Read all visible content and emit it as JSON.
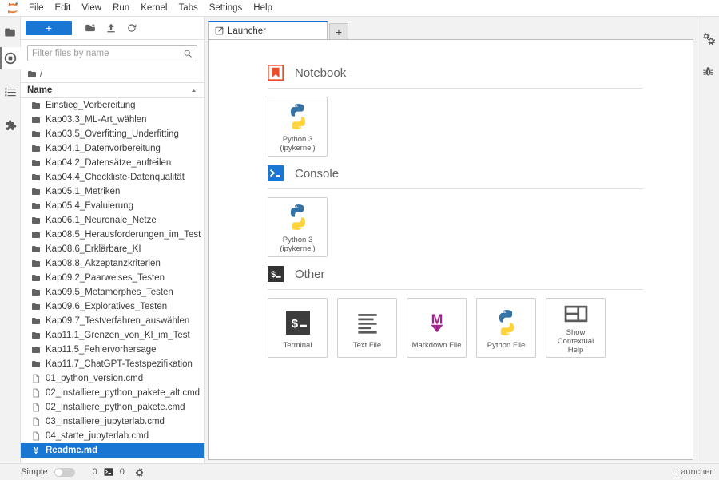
{
  "app": {
    "title": "JupyterLab",
    "logo_icon": "jupyter-logo-icon"
  },
  "menubar": {
    "items": [
      {
        "label": "File"
      },
      {
        "label": "Edit"
      },
      {
        "label": "View"
      },
      {
        "label": "Run"
      },
      {
        "label": "Kernel"
      },
      {
        "label": "Tabs"
      },
      {
        "label": "Settings"
      },
      {
        "label": "Help"
      }
    ]
  },
  "left_activity_bar": {
    "items": [
      {
        "name": "file-browser",
        "icon": "folder-icon",
        "active": true
      },
      {
        "name": "running-terminals-and-kernels",
        "icon": "stop-circle-icon",
        "active": false
      },
      {
        "name": "commands",
        "icon": "list-icon",
        "active": false
      },
      {
        "name": "extension-manager",
        "icon": "puzzle-piece-icon",
        "active": false
      }
    ]
  },
  "right_activity_bar": {
    "items": [
      {
        "name": "property-inspector",
        "icon": "gears-icon"
      },
      {
        "name": "debugger",
        "icon": "bug-icon"
      }
    ]
  },
  "file_browser": {
    "toolbar": {
      "new_launcher_label": "+",
      "new_folder_icon": "new-folder-icon",
      "upload_icon": "upload-icon",
      "refresh_icon": "refresh-icon"
    },
    "filter": {
      "placeholder": "Filter files by name",
      "value": "",
      "search_icon": "search-icon"
    },
    "breadcrumb": {
      "root_icon": "folder-icon",
      "path": "/"
    },
    "column_header": {
      "name_label": "Name",
      "sort_icon": "caret-up-icon"
    },
    "items": [
      {
        "label": "Einstieg_Vorbereitung",
        "type": "folder",
        "selected": false
      },
      {
        "label": "Kap03.3_ML-Art_wählen",
        "type": "folder",
        "selected": false
      },
      {
        "label": "Kap03.5_Overfitting_Underfitting",
        "type": "folder",
        "selected": false
      },
      {
        "label": "Kap04.1_Datenvorbereitung",
        "type": "folder",
        "selected": false
      },
      {
        "label": "Kap04.2_Datensätze_aufteilen",
        "type": "folder",
        "selected": false
      },
      {
        "label": "Kap04.4_Checkliste-Datenqualität",
        "type": "folder",
        "selected": false
      },
      {
        "label": "Kap05.1_Metriken",
        "type": "folder",
        "selected": false
      },
      {
        "label": "Kap05.4_Evaluierung",
        "type": "folder",
        "selected": false
      },
      {
        "label": "Kap06.1_Neuronale_Netze",
        "type": "folder",
        "selected": false
      },
      {
        "label": "Kap08.5_Herausforderungen_im_Test",
        "type": "folder",
        "selected": false
      },
      {
        "label": "Kap08.6_Erklärbare_KI",
        "type": "folder",
        "selected": false
      },
      {
        "label": "Kap08.8_Akzeptanzkriterien",
        "type": "folder",
        "selected": false
      },
      {
        "label": "Kap09.2_Paarweises_Testen",
        "type": "folder",
        "selected": false
      },
      {
        "label": "Kap09.5_Metamorphes_Testen",
        "type": "folder",
        "selected": false
      },
      {
        "label": "Kap09.6_Exploratives_Testen",
        "type": "folder",
        "selected": false
      },
      {
        "label": "Kap09.7_Testverfahren_auswählen",
        "type": "folder",
        "selected": false
      },
      {
        "label": "Kap11.1_Grenzen_von_KI_im_Test",
        "type": "folder",
        "selected": false
      },
      {
        "label": "Kap11.5_Fehlervorhersage",
        "type": "folder",
        "selected": false
      },
      {
        "label": "Kap11.7_ChatGPT-Testspezifikation",
        "type": "folder",
        "selected": false
      },
      {
        "label": "01_python_version.cmd",
        "type": "file",
        "selected": false
      },
      {
        "label": "02_installiere_python_pakete_alt.cmd",
        "type": "file",
        "selected": false
      },
      {
        "label": "02_installiere_python_pakete.cmd",
        "type": "file",
        "selected": false
      },
      {
        "label": "03_installiere_jupyterlab.cmd",
        "type": "file",
        "selected": false
      },
      {
        "label": "04_starte_jupyterlab.cmd",
        "type": "file",
        "selected": false
      },
      {
        "label": "Readme.md",
        "type": "markdown",
        "selected": true
      }
    ]
  },
  "dock": {
    "tab": {
      "label": "Launcher",
      "icon": "launcher-icon"
    },
    "add_tab_label": "+"
  },
  "launcher": {
    "sections": [
      {
        "title": "Notebook",
        "icon": "notebook-bookmark-icon",
        "cards": [
          {
            "label": "Python 3\n(ipykernel)",
            "label_line1": "Python 3",
            "label_line2": "(ipykernel)",
            "icon": "python-icon"
          }
        ]
      },
      {
        "title": "Console",
        "icon": "console-prompt-icon",
        "cards": [
          {
            "label": "Python 3\n(ipykernel)",
            "label_line1": "Python 3",
            "label_line2": "(ipykernel)",
            "icon": "python-icon"
          }
        ]
      },
      {
        "title": "Other",
        "icon": "terminal-dollar-icon",
        "cards": [
          {
            "label_line1": "Terminal",
            "label_line2": "",
            "icon": "terminal-icon"
          },
          {
            "label_line1": "Text File",
            "label_line2": "",
            "icon": "text-file-icon"
          },
          {
            "label_line1": "Markdown File",
            "label_line2": "",
            "icon": "markdown-icon"
          },
          {
            "label_line1": "Python File",
            "label_line2": "",
            "icon": "python-icon"
          },
          {
            "label_line1": "Show Contextual",
            "label_line2": "Help",
            "icon": "contextual-help-icon"
          }
        ]
      }
    ]
  },
  "statusbar": {
    "mode_label": "Simple",
    "mode_enabled": false,
    "kernel_count": "0",
    "terminal_icon": "terminal-icon",
    "terminal_count": "0",
    "settings_icon": "gear-icon",
    "active_tab_label": "Launcher"
  },
  "colors": {
    "accent_blue": "#1976d2",
    "notebook_orange": "#ee4b2b",
    "markdown_purple": "#a1258e",
    "python_blue": "#3572A5",
    "python_yellow": "#FFD43B",
    "terminal_dark": "#3c3c3c"
  }
}
